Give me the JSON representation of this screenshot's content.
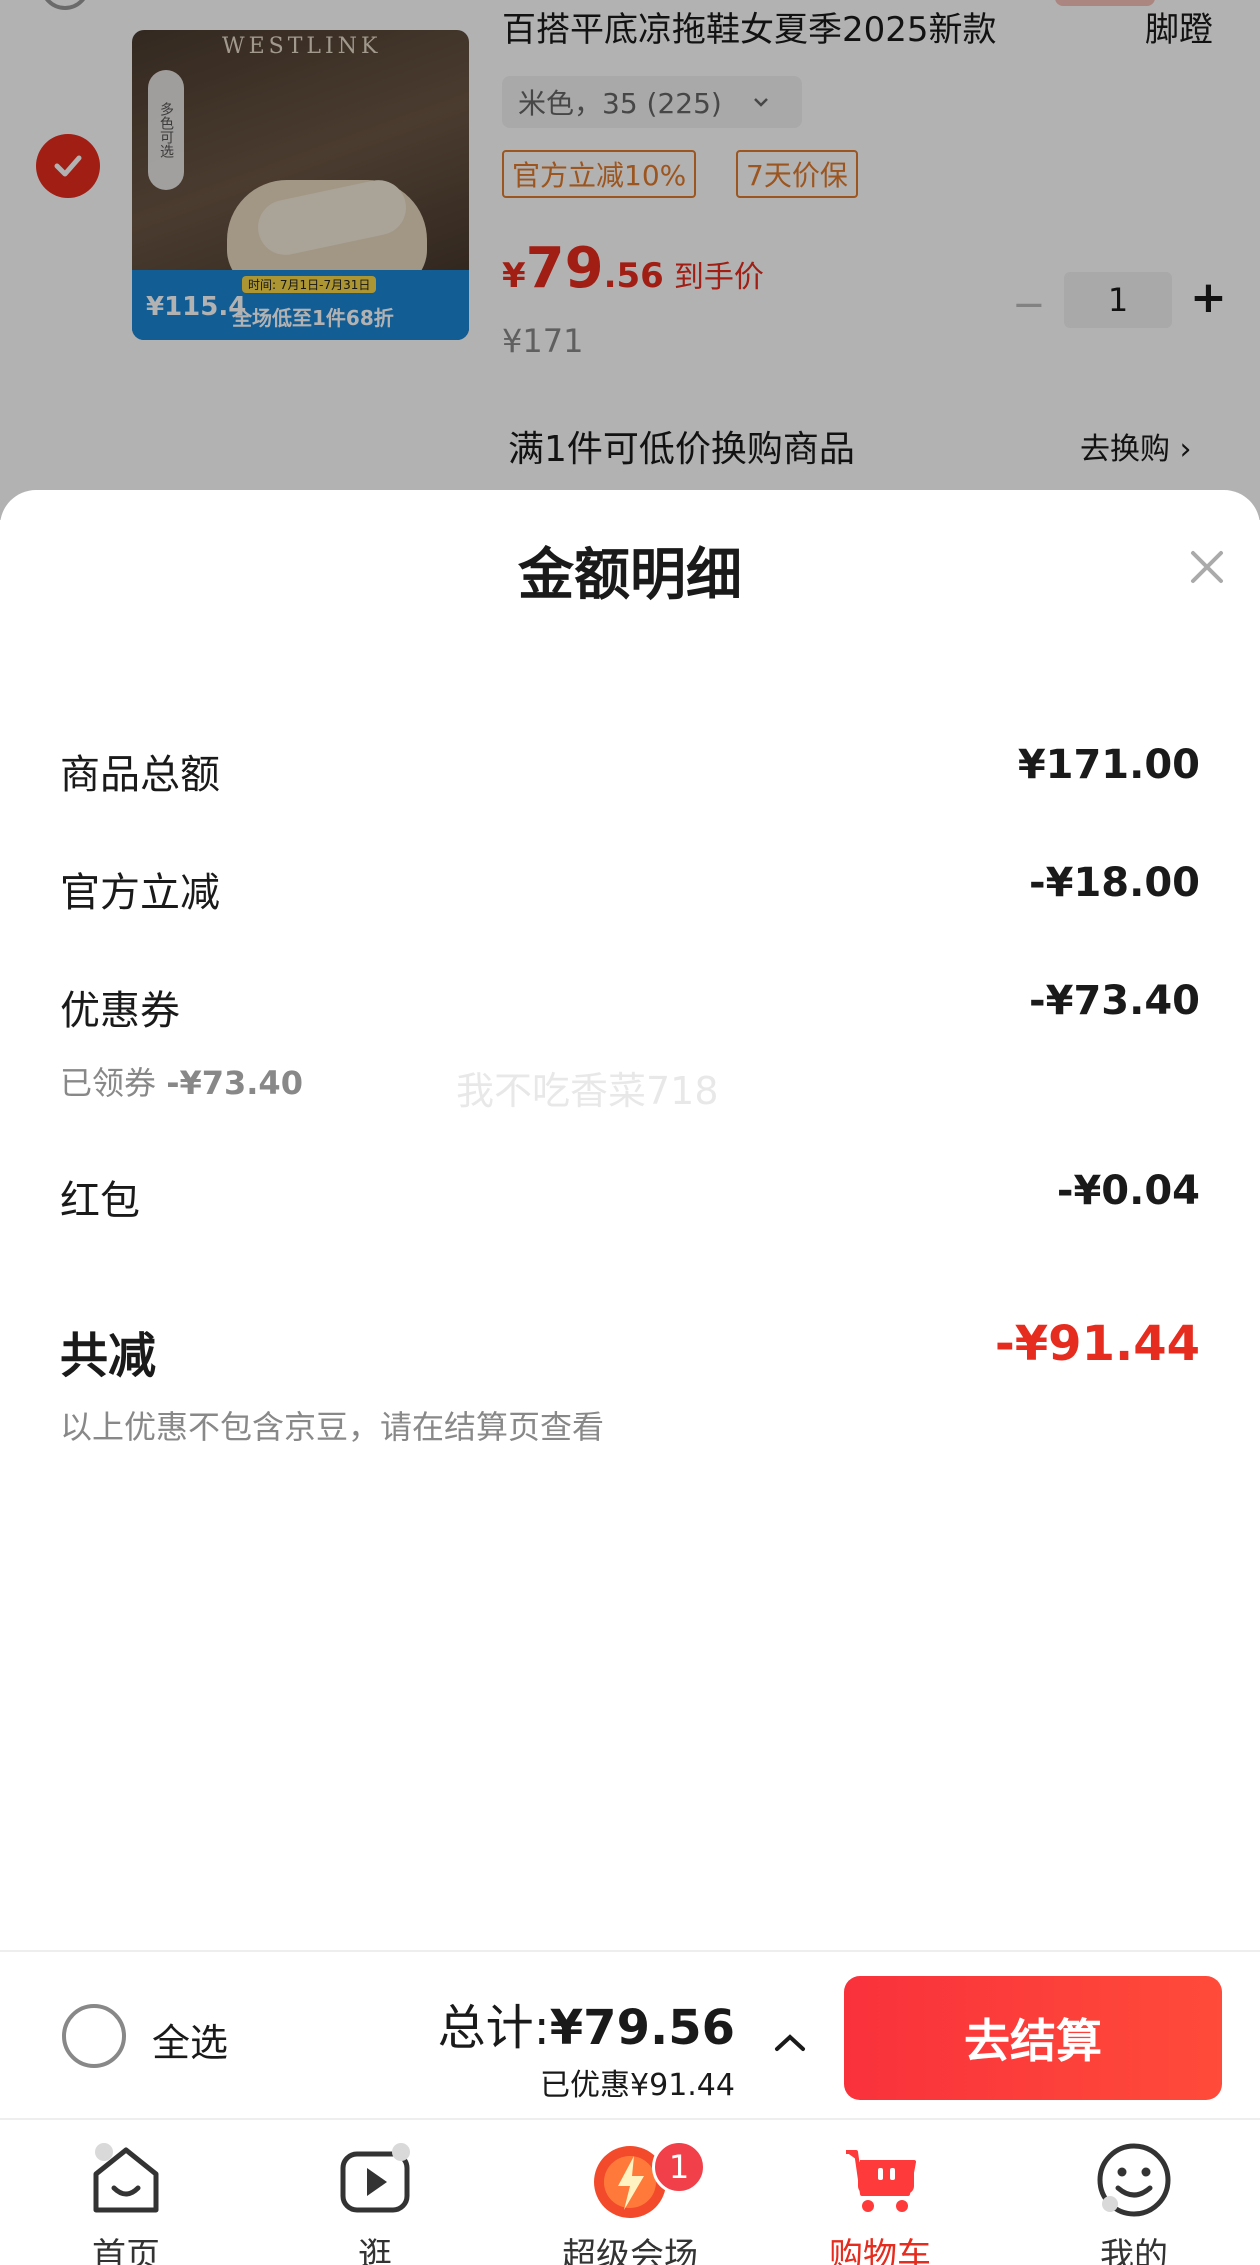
{
  "cart_item": {
    "title": "百搭平底凉拖鞋女夏季2025新款",
    "title_right": "脚蹬",
    "image_brand": "WESTLINK",
    "image_badge": "多色可选",
    "image_price": "¥115.4",
    "image_promo": "全场低至1件68折",
    "image_date": "时间: 7月1日-7月31日",
    "spec": "米色，35 (225)",
    "tags": [
      "官方立减10%",
      "7天价保"
    ],
    "price_yen": "¥",
    "price_int": "79",
    "price_dec": ".56",
    "price_label": "到手价",
    "original_price": "¥171",
    "qty": "1",
    "qty_minus": "−",
    "qty_plus": "+",
    "swap_text": "满1件可低价换购商品",
    "swap_link": "去换购 ›"
  },
  "sheet": {
    "title": "金额明细",
    "rows": [
      {
        "label": "商品总额",
        "value": "¥171.00"
      },
      {
        "label": "官方立减",
        "value": "-¥18.00"
      },
      {
        "label": "优惠券",
        "value": "-¥73.40"
      },
      {
        "label": "红包",
        "value": "-¥0.04"
      }
    ],
    "coupon_note_prefix": "已领券",
    "coupon_note_value": "-¥73.40",
    "total_label": "共减",
    "total_value": "-¥91.44",
    "note": "以上优惠不包含京豆，请在结算页查看",
    "watermark": "我不吃香菜718"
  },
  "checkout": {
    "select_all": "全选",
    "sum_prefix": "总计:",
    "sum_amount": "¥79.56",
    "saved": "已优惠¥91.44",
    "button": "去结算"
  },
  "tabs": [
    {
      "label": "首页",
      "icon": "home-icon"
    },
    {
      "label": "逛",
      "icon": "video-play-icon"
    },
    {
      "label": "超级会场",
      "icon": "super-venue-icon",
      "badge": "1"
    },
    {
      "label": "购物车",
      "icon": "cart-icon",
      "active": true
    },
    {
      "label": "我的",
      "icon": "smiley-icon"
    }
  ],
  "colors": {
    "accent": "#e62c1e",
    "checkout_button": "#f9313b",
    "tag_orange": "#e07a2c",
    "muted_text": "#888888"
  }
}
